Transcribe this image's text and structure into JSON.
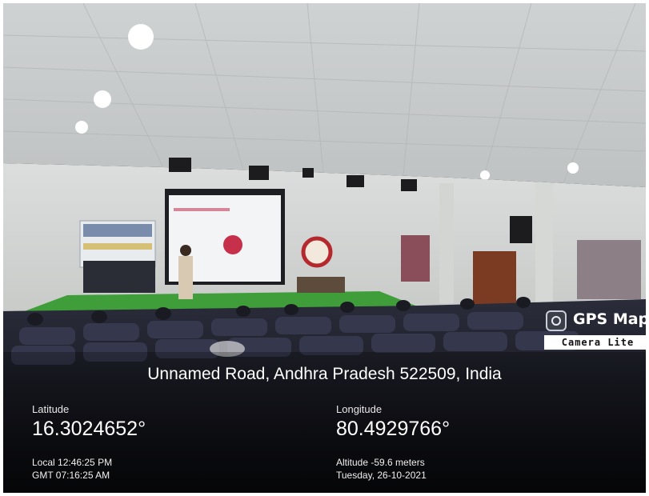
{
  "photo": {
    "description_icon": "photo-of-auditorium-presentation"
  },
  "badge": {
    "title": "GPS Map",
    "subtitle": "Camera Lite",
    "icon": "camera-icon"
  },
  "location": {
    "address": "Unnamed Road, Andhra Pradesh 522509, India",
    "latitude_label": "Latitude",
    "latitude_value": "16.3024652°",
    "longitude_label": "Longitude",
    "longitude_value": "80.4929766°",
    "local_time": "Local 12:46:25 PM",
    "gmt_time": "GMT 07:16:25 AM",
    "altitude": "Altitude -59.6 meters",
    "date": "Tuesday, 26-10-2021"
  }
}
